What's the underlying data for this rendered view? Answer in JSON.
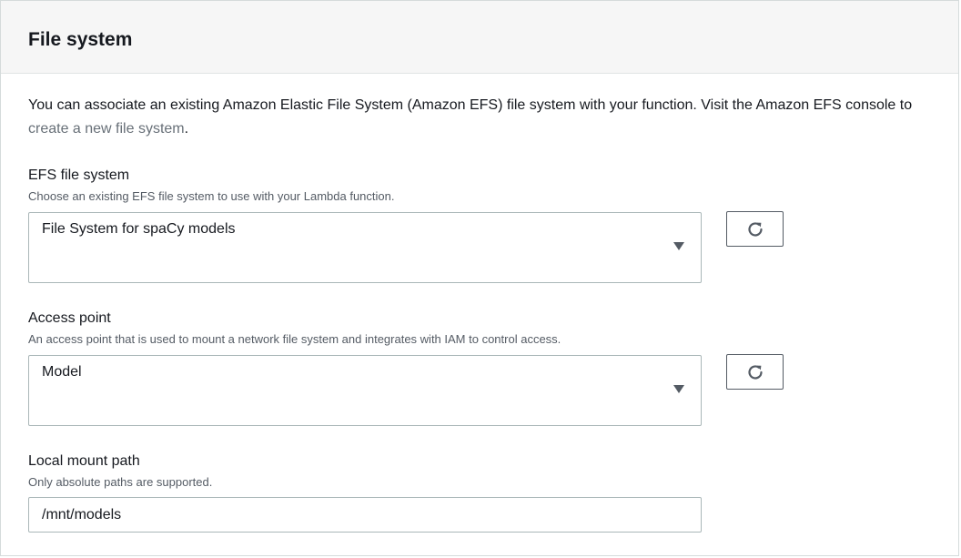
{
  "panel": {
    "title": "File system",
    "description_text": "You can associate an existing Amazon Elastic File System (Amazon EFS) file system with your function. Visit the Amazon EFS console to ",
    "description_link": "create a new file system",
    "description_end": "."
  },
  "efs_field": {
    "label": "EFS file system",
    "hint": "Choose an existing EFS file system to use with your Lambda function.",
    "selected_value": "File System for spaCy models"
  },
  "access_point_field": {
    "label": "Access point",
    "hint": "An access point that is used to mount a network file system and integrates with IAM to control access.",
    "selected_value": "Model"
  },
  "mount_path_field": {
    "label": "Local mount path",
    "hint": "Only absolute paths are supported.",
    "value": "/mnt/models"
  },
  "icons": {
    "refresh": "refresh-icon",
    "caret": "caret-down-icon"
  },
  "colors": {
    "link": "#687078",
    "header_background": "#f6f6f6",
    "border": "#aab7b8"
  }
}
